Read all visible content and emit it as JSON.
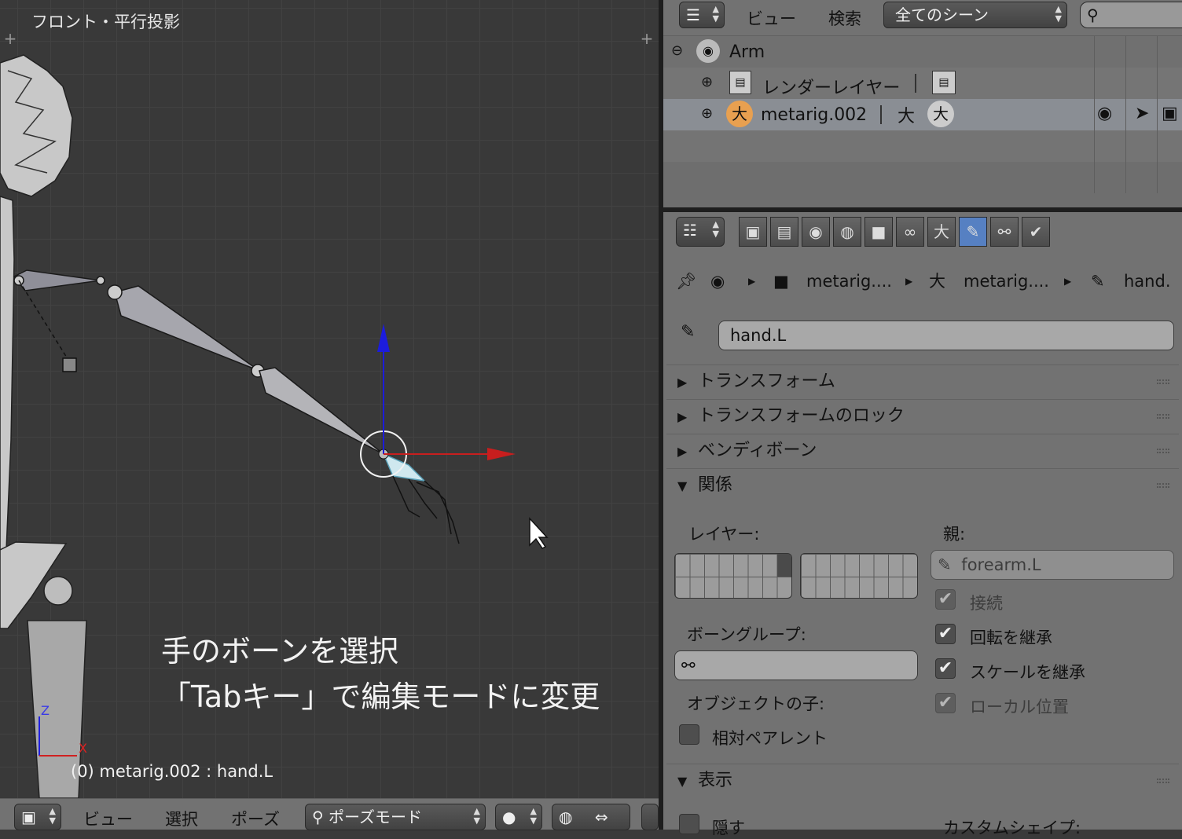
{
  "viewport": {
    "title": "フロント・平行投影",
    "caption_line1": "手のボーンを選択",
    "caption_line2": "「Tabキー」で編集モードに変更",
    "status": "(0) metarig.002 : hand.L",
    "axis_z": "Z",
    "axis_x": "X"
  },
  "viewport_header": {
    "menu_view": "ビュー",
    "menu_select": "選択",
    "menu_pose": "ポーズ",
    "mode": "ポーズモード"
  },
  "outliner": {
    "menu_view": "ビュー",
    "menu_search": "検索",
    "scene_filter": "全てのシーン",
    "items": [
      {
        "label": "Arm"
      },
      {
        "label": "レンダーレイヤー"
      },
      {
        "label": "metarig.002"
      }
    ]
  },
  "properties": {
    "breadcrumb": [
      "metarig....",
      "metarig....",
      "hand."
    ],
    "bone_name": "hand.L",
    "panels": {
      "transform": "トランスフォーム",
      "transform_lock": "トランスフォームのロック",
      "bendy_bones": "ベンディボーン",
      "relations": "関係",
      "display": "表示"
    },
    "relations": {
      "layers_label": "レイヤー:",
      "parent_label": "親:",
      "parent_value": "forearm.L",
      "connected": "接続",
      "inherit_rotation": "回転を継承",
      "inherit_scale": "スケールを継承",
      "local_location": "ローカル位置",
      "bone_group_label": "ボーングループ:",
      "object_children_label": "オブジェクトの子:",
      "relative_parent": "相対ペアレント"
    },
    "display": {
      "hide": "隠す",
      "custom_shape": "カスタムシェイプ:"
    }
  },
  "colors": {
    "viewport_bg": "#393939",
    "panel_bg": "#727272",
    "selected_tab": "#5680c2",
    "axis_x": "#c81e1e",
    "axis_z": "#1e1ec8"
  }
}
